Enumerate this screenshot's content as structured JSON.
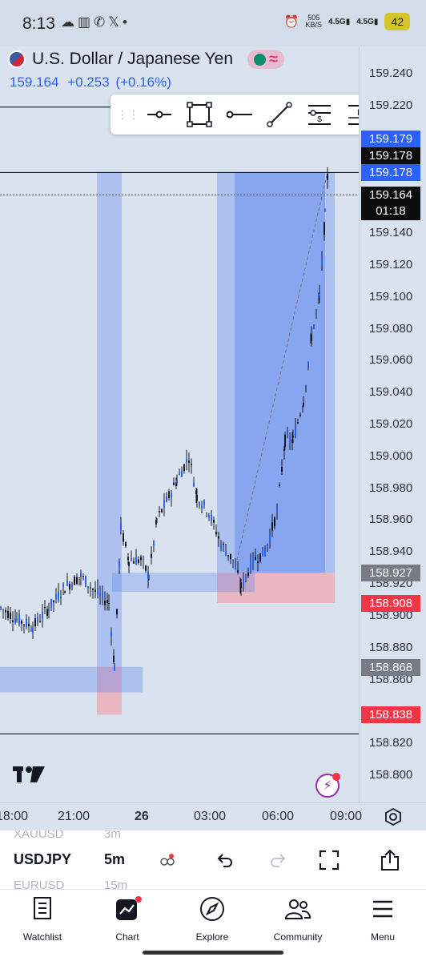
{
  "status_bar": {
    "time": "8:13",
    "net_speed": "505",
    "net_unit": "KB/S",
    "signal1": "4.5G",
    "signal2": "4.5G",
    "battery": "42"
  },
  "symbol": {
    "name": "U.S. Dollar / Japanese Yen",
    "price": "159.164",
    "change": "+0.253",
    "change_pct": "(+0.16%)"
  },
  "drawing_toolbar": {
    "tools": [
      "horizontal-ray-icon",
      "rectangle-icon",
      "ray-icon",
      "trend-line-icon",
      "position-icon",
      "label-icon"
    ],
    "position_label": "$",
    "label_letter": "L"
  },
  "price_axis": {
    "ticks": [
      "159.240",
      "159.220",
      "159.140",
      "159.120",
      "159.100",
      "159.080",
      "159.060",
      "159.040",
      "159.020",
      "159.000",
      "158.980",
      "158.960",
      "158.940",
      "158.920",
      "158.900",
      "158.880",
      "158.860",
      "158.820",
      "158.800"
    ],
    "tags": [
      {
        "value": "159.179",
        "style": "blue"
      },
      {
        "value": "159.178",
        "style": "dark"
      },
      {
        "value": "159.178",
        "style": "blue"
      },
      {
        "value": "159.164",
        "style": "dark",
        "countdown": "01:18"
      },
      {
        "value": "158.927",
        "style": "grey"
      },
      {
        "value": "158.908",
        "style": "red"
      },
      {
        "value": "158.868",
        "style": "grey"
      },
      {
        "value": "158.838",
        "style": "red"
      }
    ]
  },
  "time_axis": {
    "labels": [
      "18:00",
      "21:00",
      "26",
      "03:00",
      "06:00",
      "09:00"
    ]
  },
  "chart_data": {
    "type": "candlestick",
    "symbol": "USDJPY",
    "interval": "5m",
    "ylim": [
      158.79,
      159.25
    ],
    "current_price": 159.164
  },
  "bottom_toolbar": {
    "symbol_prev": "XAUUSD",
    "symbol": "USDJPY",
    "symbol_next": "EURUSD",
    "interval_prev": "3m",
    "interval": "5m",
    "interval_next": "15m"
  },
  "nav": [
    {
      "label": "Watchlist"
    },
    {
      "label": "Chart"
    },
    {
      "label": "Explore"
    },
    {
      "label": "Community"
    },
    {
      "label": "Menu"
    }
  ],
  "colors": {
    "accent": "#2962ff",
    "down": "#f23645",
    "zone_blue": "#5b82f0",
    "zone_red": "#f0a3ad"
  }
}
